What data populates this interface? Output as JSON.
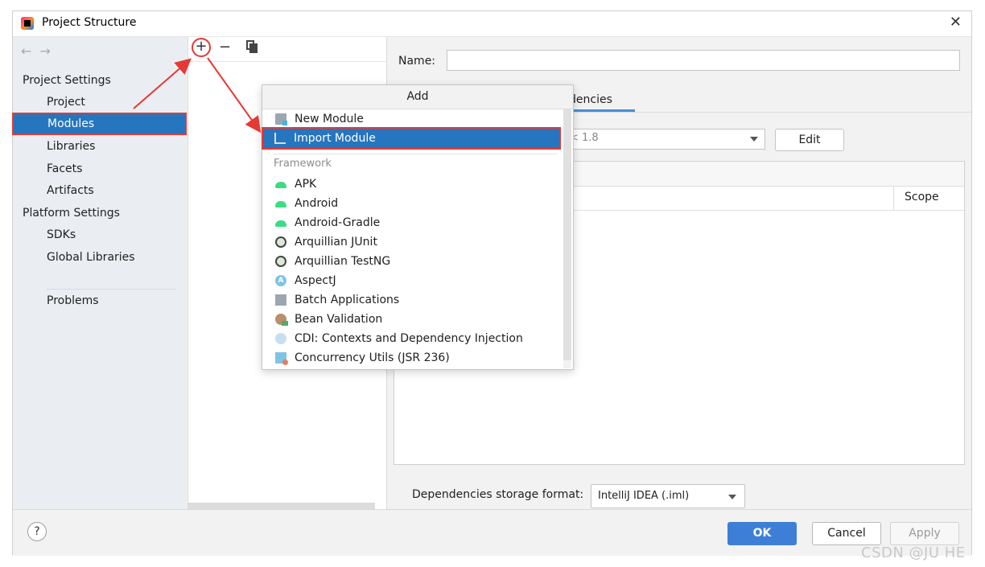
{
  "window": {
    "title": "Project Structure"
  },
  "sidebar": {
    "project_settings_header": "Project Settings",
    "platform_settings_header": "Platform Settings",
    "items": [
      {
        "label": "Project"
      },
      {
        "label": "Modules"
      },
      {
        "label": "Libraries"
      },
      {
        "label": "Facets"
      },
      {
        "label": "Artifacts"
      },
      {
        "label": "SDKs"
      },
      {
        "label": "Global Libraries"
      },
      {
        "label": "Problems"
      }
    ],
    "selected": "Modules"
  },
  "module_toolbar": {
    "add": "+",
    "remove": "−"
  },
  "right_panel": {
    "name_label": "Name:",
    "name_value": "",
    "tab_dependencies_partial": "dencies",
    "sdk_value_partial": "< 1.8",
    "edit_label": "Edit",
    "scope_header": "Scope",
    "storage_format_label": "Dependencies storage format:",
    "storage_format_value": "IntelliJ IDEA (.iml)"
  },
  "popup": {
    "title": "Add",
    "items": [
      {
        "label": "New Module",
        "icon": "folder-module-icon"
      },
      {
        "label": "Import Module",
        "icon": "import-module-icon",
        "selected": true
      }
    ],
    "group_label": "Framework",
    "framework_items": [
      {
        "label": "APK",
        "icon": "android-icon"
      },
      {
        "label": "Android",
        "icon": "android-icon"
      },
      {
        "label": "Android-Gradle",
        "icon": "android-icon"
      },
      {
        "label": "Arquillian JUnit",
        "icon": "arquillian-icon"
      },
      {
        "label": "Arquillian TestNG",
        "icon": "arquillian-icon"
      },
      {
        "label": "AspectJ",
        "icon": "aspectj-icon",
        "glyph": "A"
      },
      {
        "label": "Batch Applications",
        "icon": "batch-icon"
      },
      {
        "label": "Bean Validation",
        "icon": "bean-validation-icon"
      },
      {
        "label": "CDI: Contexts and Dependency Injection",
        "icon": "cdi-icon"
      },
      {
        "label": "Concurrency Utils (JSR 236)",
        "icon": "concurrency-icon"
      }
    ]
  },
  "footer": {
    "help": "?",
    "ok": "OK",
    "cancel": "Cancel",
    "apply": "Apply"
  },
  "watermark": "CSDN @JU HE",
  "colors": {
    "selection": "#2675bf",
    "annotation": "#e53935",
    "ok_button": "#3d7fd6"
  }
}
